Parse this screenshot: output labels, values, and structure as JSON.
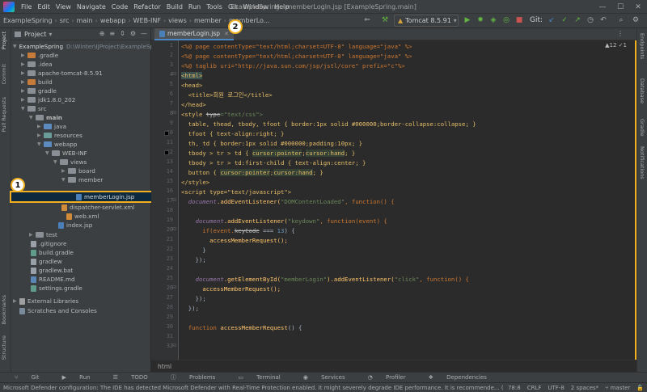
{
  "window": {
    "title": "ExampleSpring - memberLogin.jsp [ExampleSpring.main]",
    "menu": [
      "File",
      "Edit",
      "View",
      "Navigate",
      "Code",
      "Refactor",
      "Build",
      "Run",
      "Tools",
      "Git",
      "Window",
      "Help"
    ]
  },
  "breadcrumbs": [
    "ExampleSpring",
    "src",
    "main",
    "webapp",
    "WEB-INF",
    "views",
    "member",
    "memberLo..."
  ],
  "toolbar": {
    "run_config": "Tomcat 8.5.91",
    "git_label": "Git:"
  },
  "left_strip": [
    "Project",
    "Commit",
    "Pull Requests",
    "Bookmarks",
    "Structure"
  ],
  "right_strip": [
    "Endpoints",
    "Database",
    "Gradle",
    "Notifications"
  ],
  "project_panel": {
    "title": "Project",
    "root": {
      "name": "ExampleSpring",
      "path": "D:\\Winter\\IJProject\\ExampleSpring"
    },
    "items": [
      {
        "label": ".gradle",
        "icon": "folder-orange"
      },
      {
        "label": ".idea",
        "icon": "folder"
      },
      {
        "label": "apache-tomcat-8.5.91",
        "icon": "folder"
      },
      {
        "label": "build",
        "icon": "folder-orange"
      },
      {
        "label": "gradle",
        "icon": "folder"
      },
      {
        "label": "jdk1.8.0_202",
        "icon": "folder"
      },
      {
        "label": "src",
        "icon": "folder"
      },
      {
        "label": "main",
        "icon": "folder"
      },
      {
        "label": "java",
        "icon": "folder-blue"
      },
      {
        "label": "resources",
        "icon": "folder-teal"
      },
      {
        "label": "webapp",
        "icon": "folder-blue"
      },
      {
        "label": "WEB-INF",
        "icon": "folder"
      },
      {
        "label": "views",
        "icon": "folder"
      },
      {
        "label": "board",
        "icon": "folder"
      },
      {
        "label": "member",
        "icon": "folder"
      },
      {
        "label": "memberLogin.jsp",
        "icon": "jsp-file"
      },
      {
        "label": "dispatcher-servlet.xml",
        "icon": "xml-file"
      },
      {
        "label": "web.xml",
        "icon": "xml-file"
      },
      {
        "label": "index.jsp",
        "icon": "jsp-file"
      },
      {
        "label": "test",
        "icon": "folder"
      },
      {
        "label": ".gitignore",
        "icon": "file"
      },
      {
        "label": "build.gradle",
        "icon": "gradle-file"
      },
      {
        "label": "gradlew",
        "icon": "file"
      },
      {
        "label": "gradlew.bat",
        "icon": "file"
      },
      {
        "label": "README.md",
        "icon": "md-file"
      },
      {
        "label": "settings.gradle",
        "icon": "gradle-file"
      },
      {
        "label": "External Libraries",
        "icon": "library"
      },
      {
        "label": "Scratches and Consoles",
        "icon": "scratch"
      }
    ]
  },
  "editor": {
    "tab": "memberLogin.jsp",
    "warnings": "▲12  ✓1",
    "footer": "html",
    "line_numbers": [
      "1",
      "2",
      "3",
      "4",
      "5",
      "6",
      "7",
      "8",
      "9",
      "10",
      "11",
      "12",
      "13",
      "14",
      "15",
      "16",
      "17",
      "18",
      "19",
      "20",
      "21",
      "22",
      "23",
      "24",
      "25",
      "26",
      "27",
      "28",
      "29",
      "30",
      "31",
      "32"
    ],
    "code": {
      "l1": "<%@ page contentType=\"text/html;charset=UTF-8\" language=\"java\" %>",
      "l2": "<%@ page contentType=\"text/html;charset=UTF-8\" language=\"java\" %>",
      "l3": "<%@ taglib uri=\"http://java.sun.com/jsp/jstl/core\" prefix=\"c\"%>",
      "l4": "<html>",
      "l5": "<head>",
      "l6": "  <title>회원 로그인</title>",
      "l7": "</head>",
      "l8a": "<style ",
      "l8b": "type",
      "l8c": "=\"text/css\">",
      "l9": "  table, thead, tbody, tfoot { border:1px solid #000000;border-collapse:collapse; }",
      "l10": "  tfoot { text-align:right; }",
      "l11": "  th, td { border:1px solid #000000;padding:10px; }",
      "l12a": "  tbody > tr > td { ",
      "l12b": "cursor:pointer",
      "l12c": ";",
      "l12d": "cursor:hand",
      "l12e": "; }",
      "l13a": "  tbody > tr > td:first-child { text-align:center; }",
      "l14a": "  button { ",
      "l14b": "cursor:pointer",
      "l14c": ";",
      "l14d": "cursor:hand",
      "l14e": "; }",
      "l15": "</style>",
      "l16": "<script type=\"text/javascript\">",
      "l17a": "  document",
      "l17b": ".addEventListener(",
      "l17c": "\"DOMContentLoaded\"",
      "l17d": ", function() {",
      "l19a": "    document",
      "l19b": ".addEventListener(",
      "l19c": "\"keydown\"",
      "l19d": ", function(event) {",
      "l20a": "      if(event.",
      "l20b": "keyCode",
      "l20c": " === ",
      "l20d": "13",
      "l20e": ") {",
      "l21": "        accessMemberRequest();",
      "l22": "      }",
      "l23": "    });",
      "l25a": "    document",
      "l25b": ".getElementById(",
      "l25c": "\"memberLogin\"",
      "l25d": ").addEventListener(",
      "l25e": "\"click\"",
      "l25f": ", function() {",
      "l26": "      accessMemberRequest();",
      "l27": "    });",
      "l28": "  });",
      "l30a": "  function ",
      "l30b": "accessMemberRequest",
      "l30c": "() {"
    }
  },
  "tool_windows": [
    "Git",
    "Run",
    "TODO",
    "Problems",
    "Terminal",
    "Services",
    "Profiler",
    "Dependencies"
  ],
  "status": {
    "message": "Microsoft Defender configuration: The IDE has detected Microsoft Defender with Real-Time Protection enabled. It might severely degrade IDE performance. It is recommende... (37 minutes a",
    "pos": "78:8",
    "eol": "CRLF",
    "enc": "UTF-8",
    "indent": "2 spaces*",
    "branch": "master"
  },
  "callouts": [
    "1",
    "2"
  ]
}
